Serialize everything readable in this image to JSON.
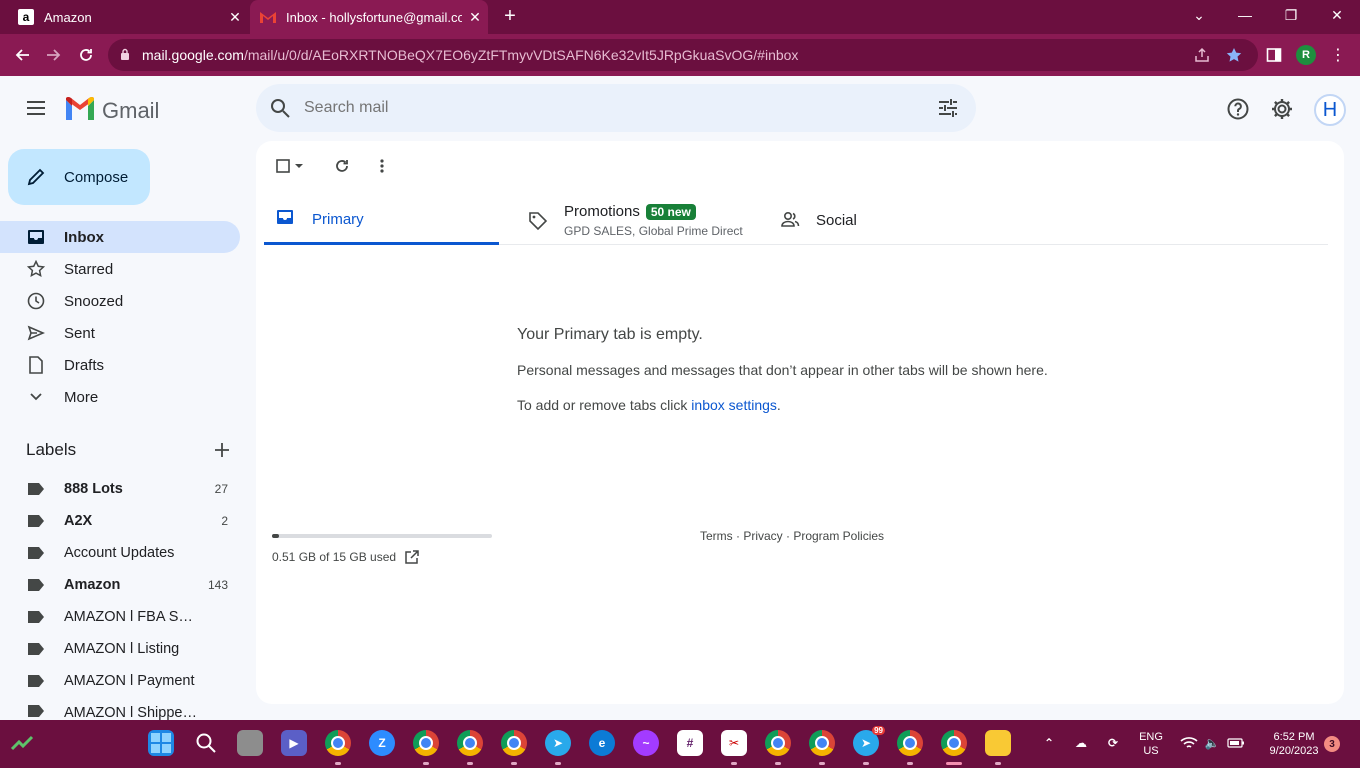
{
  "browser": {
    "tabs": [
      {
        "title": "Amazon",
        "favicon": "amazon-icon",
        "active": false
      },
      {
        "title": "Inbox - hollysfortune@gmail.com",
        "favicon": "gmail-icon",
        "active": true
      }
    ],
    "url_host": "mail.google.com",
    "url_path": "/mail/u/0/d/AEoRXRTNOBeQX7EO6yZtFTmyvVDtSAFN6Ke32vIt5JRpGkuaSvOG/#inbox",
    "profile_initial": "R"
  },
  "gmail": {
    "app_name": "Gmail",
    "search_placeholder": "Search mail",
    "account_initial": "H",
    "compose_label": "Compose",
    "nav": [
      {
        "label": "Inbox",
        "icon": "inbox-icon",
        "active": true
      },
      {
        "label": "Starred",
        "icon": "star-icon"
      },
      {
        "label": "Snoozed",
        "icon": "clock-icon"
      },
      {
        "label": "Sent",
        "icon": "send-icon"
      },
      {
        "label": "Drafts",
        "icon": "draft-icon"
      },
      {
        "label": "More",
        "icon": "chevron-down-icon"
      }
    ],
    "labels_heading": "Labels",
    "labels": [
      {
        "name": "888 Lots",
        "count": "27",
        "bold": true
      },
      {
        "name": "A2X",
        "count": "2",
        "bold": true
      },
      {
        "name": "Account Updates",
        "count": "",
        "bold": false
      },
      {
        "name": "Amazon",
        "count": "143",
        "bold": true
      },
      {
        "name": "AMAZON l FBA Shipmen...",
        "count": "",
        "bold": false
      },
      {
        "name": "AMAZON l Listing",
        "count": "",
        "bold": false
      },
      {
        "name": "AMAZON l Payment",
        "count": "",
        "bold": false
      },
      {
        "name": "AMAZON l Shipped Order",
        "count": "",
        "bold": false
      }
    ],
    "categories": {
      "primary": "Primary",
      "promotions": "Promotions",
      "promotions_badge": "50 new",
      "promotions_sub": "GPD SALES, Global Prime Direct",
      "social": "Social"
    },
    "empty": {
      "title": "Your Primary tab is empty.",
      "line1": "Personal messages and messages that don’t appear in other tabs will be shown here.",
      "line2_prefix": "To add or remove tabs click ",
      "line2_link": "inbox settings",
      "line2_suffix": "."
    },
    "storage": {
      "text": "0.51 GB of 15 GB used",
      "fraction": 0.034
    },
    "footer": "Terms · Privacy · Program Policies"
  },
  "taskbar": {
    "lang": "ENG",
    "region": "US",
    "time": "6:52 PM",
    "date": "9/20/2023",
    "notification_count": "3",
    "telegram_badge": "99"
  },
  "colors": {
    "chrome_frame": "#6b0f3f",
    "chrome_toolbar": "#8a1a53",
    "gmail_bg": "#f6f8fc",
    "compose_bg": "#c2e7ff",
    "active_nav": "#d3e3fd",
    "accent_blue": "#0b57d0",
    "badge_green": "#188038"
  }
}
